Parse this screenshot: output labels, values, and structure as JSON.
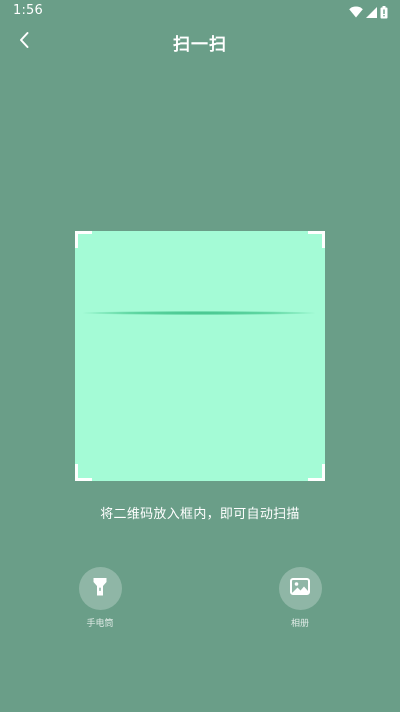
{
  "status_bar": {
    "time": "1:56",
    "icons": [
      "wifi-icon",
      "signal-icon",
      "battery-icon"
    ]
  },
  "toolbar": {
    "back_icon": "chevron-left-icon",
    "title": "扫一扫"
  },
  "scanner": {
    "hint": "将二维码放入框内，即可自动扫描",
    "frame_color": "#a4fbd6",
    "line_color": "#3fc08a"
  },
  "actions": {
    "flashlight": {
      "label": "手电筒",
      "icon": "flashlight-icon"
    },
    "album": {
      "label": "相册",
      "icon": "image-icon"
    }
  },
  "colors": {
    "background": "#6a9e88",
    "text": "#ffffff"
  }
}
